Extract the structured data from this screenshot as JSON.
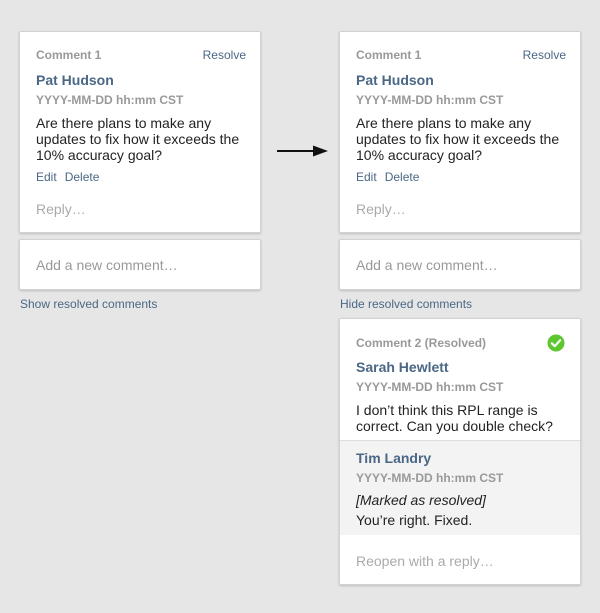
{
  "left": {
    "comment": {
      "number_label": "Comment 1",
      "resolve_label": "Resolve",
      "author": "Pat Hudson",
      "timestamp": "YYYY-MM-DD hh:mm CST",
      "body_lines": [
        "Are there plans to make any",
        "updates to fix how it exceeds the",
        "10% accuracy goal?"
      ],
      "edit_label": "Edit",
      "delete_label": "Delete",
      "reply_placeholder": "Reply…"
    },
    "add_comment_placeholder": "Add a new comment…",
    "toggle_label": "Show resolved comments"
  },
  "right": {
    "comment": {
      "number_label": "Comment 1",
      "resolve_label": "Resolve",
      "author": "Pat Hudson",
      "timestamp": "YYYY-MM-DD hh:mm CST",
      "body_lines": [
        "Are there plans to make any",
        "updates to fix how it exceeds the",
        "10% accuracy goal?"
      ],
      "edit_label": "Edit",
      "delete_label": "Delete",
      "reply_placeholder": "Reply…"
    },
    "add_comment_placeholder": "Add a new comment…",
    "toggle_label": "Hide resolved comments",
    "resolved_comment": {
      "number_label": "Comment 2 (Resolved)",
      "status_icon": "check-circle-icon",
      "author": "Sarah Hewlett",
      "timestamp": "YYYY-MM-DD hh:mm CST",
      "body_lines": [
        "I don’t think this RPL range is",
        "correct. Can you double check?"
      ],
      "reply": {
        "author": "Tim Landry",
        "timestamp": "YYYY-MM-DD hh:mm CST",
        "status_text": "[Marked as resolved]",
        "body": "You’re right. Fixed."
      },
      "reopen_placeholder": "Reopen with a reply…"
    }
  },
  "colors": {
    "background": "#e6e6e6",
    "link": "#4a6785",
    "muted": "#999999",
    "resolved_green": "#5cc72f"
  }
}
